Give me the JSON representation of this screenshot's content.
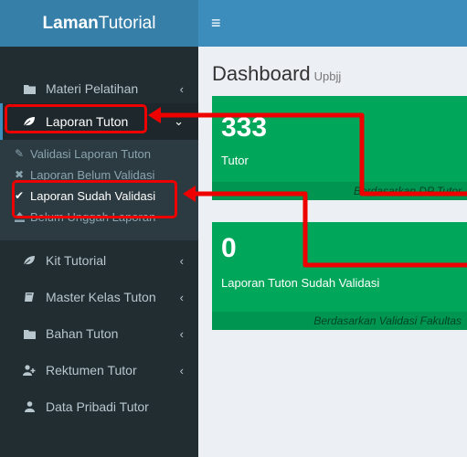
{
  "logo": {
    "bold": "Laman",
    "light": "Tutorial"
  },
  "header": {
    "menu_icon": "hamburger-icon"
  },
  "sidebar": {
    "items": [
      {
        "label": "Materi Pelatihan",
        "icon": "folder-icon"
      },
      {
        "label": "Laporan Tuton",
        "icon": "leaf-icon"
      },
      {
        "label": "Kit Tutorial",
        "icon": "leaf-icon"
      },
      {
        "label": "Master Kelas Tuton",
        "icon": "book-icon"
      },
      {
        "label": "Bahan Tuton",
        "icon": "folder-icon"
      },
      {
        "label": "Rektumen Tutor",
        "icon": "user-plus-icon"
      },
      {
        "label": "Data Pribadi Tutor",
        "icon": "user-icon"
      }
    ],
    "submenu": [
      {
        "label": "Validasi Laporan Tuton",
        "icon": "edit-icon"
      },
      {
        "label": "Laporan Belum Validasi",
        "icon": "times-icon"
      },
      {
        "label": "Laporan Sudah Validasi",
        "icon": "check-icon"
      },
      {
        "label": "Belum Unggah Laporan",
        "icon": "upload-icon"
      }
    ]
  },
  "content": {
    "title": "Dashboard",
    "subtitle": "Upbjj",
    "boxes": [
      {
        "number": "333",
        "label": "Tutor",
        "footer": "Berdasarkan DP Tutor"
      },
      {
        "number": "0",
        "label": "Laporan Tuton Sudah Validasi",
        "footer": "Berdasarkan Validasi Fakultas"
      }
    ]
  },
  "colors": {
    "sidebar": "#222d32",
    "header": "#3c8dbc",
    "logo": "#367fa9",
    "box": "#00a65a",
    "annotation": "#ee0000"
  }
}
